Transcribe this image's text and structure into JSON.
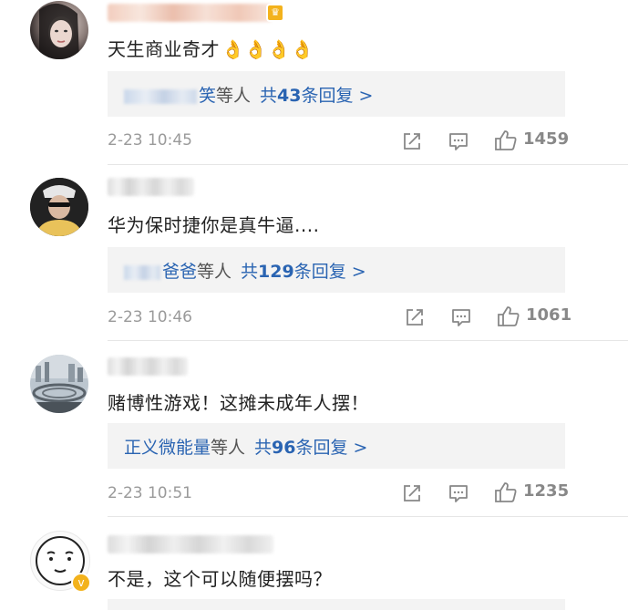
{
  "comments": [
    {
      "avatar": "avatar-photo-woman",
      "content": "天生商业奇才",
      "emoji": "👌👌👌👌",
      "reply_suffix": "等人",
      "reply_name_visible": "笑",
      "reply_count_prefix": "共",
      "reply_count_num": "43",
      "reply_count_suffix": "条回复 >",
      "timestamp": "2-23 10:45",
      "likes": "1459"
    },
    {
      "avatar": "avatar-photo-man",
      "content": "华为保时捷你是真牛逼....",
      "reply_suffix": "等人",
      "reply_name_visible": "爸爸",
      "reply_count_prefix": "共",
      "reply_count_num": "129",
      "reply_count_suffix": "条回复 >",
      "timestamp": "2-23 10:46",
      "likes": "1061"
    },
    {
      "avatar": "avatar-photo-cityscape",
      "content": "赌博性游戏！这摊未成年人摆！",
      "reply_name": "正义微能量",
      "reply_suffix": "等人",
      "reply_count_prefix": "共",
      "reply_count_num": "96",
      "reply_count_suffix": "条回复 >",
      "timestamp": "2-23 10:51",
      "likes": "1235"
    },
    {
      "avatar": "avatar-cartoon-face",
      "content": "不是，这个可以随便摆吗？",
      "verified_badge": "v"
    }
  ],
  "colors": {
    "link": "#2a64b2",
    "reply_bg": "#f3f3f3",
    "meta": "#9a9a9a",
    "vip": "#f3b21c"
  }
}
